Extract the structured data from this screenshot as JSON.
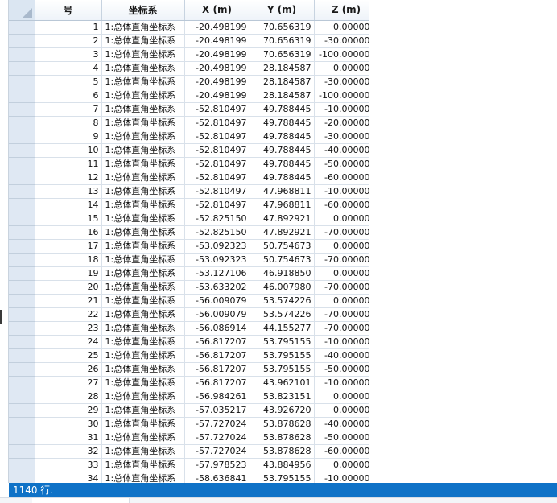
{
  "table": {
    "columns": [
      "",
      "号",
      "坐标系",
      "X (m)",
      "Y (m)",
      "Z (m)"
    ],
    "rows": [
      [
        "1",
        "1:总体直角坐标系",
        "-20.498199",
        "70.656319",
        "0.000000"
      ],
      [
        "2",
        "1:总体直角坐标系",
        "-20.498199",
        "70.656319",
        "-30.000000"
      ],
      [
        "3",
        "1:总体直角坐标系",
        "-20.498199",
        "70.656319",
        "-100.000000"
      ],
      [
        "4",
        "1:总体直角坐标系",
        "-20.498199",
        "28.184587",
        "0.000000"
      ],
      [
        "5",
        "1:总体直角坐标系",
        "-20.498199",
        "28.184587",
        "-30.000000"
      ],
      [
        "6",
        "1:总体直角坐标系",
        "-20.498199",
        "28.184587",
        "-100.000000"
      ],
      [
        "7",
        "1:总体直角坐标系",
        "-52.810497",
        "49.788445",
        "-10.000000"
      ],
      [
        "8",
        "1:总体直角坐标系",
        "-52.810497",
        "49.788445",
        "-20.000000"
      ],
      [
        "9",
        "1:总体直角坐标系",
        "-52.810497",
        "49.788445",
        "-30.000000"
      ],
      [
        "10",
        "1:总体直角坐标系",
        "-52.810497",
        "49.788445",
        "-40.000000"
      ],
      [
        "11",
        "1:总体直角坐标系",
        "-52.810497",
        "49.788445",
        "-50.000000"
      ],
      [
        "12",
        "1:总体直角坐标系",
        "-52.810497",
        "49.788445",
        "-60.000000"
      ],
      [
        "13",
        "1:总体直角坐标系",
        "-52.810497",
        "47.968811",
        "-10.000000"
      ],
      [
        "14",
        "1:总体直角坐标系",
        "-52.810497",
        "47.968811",
        "-60.000000"
      ],
      [
        "15",
        "1:总体直角坐标系",
        "-52.825150",
        "47.892921",
        "0.000000"
      ],
      [
        "16",
        "1:总体直角坐标系",
        "-52.825150",
        "47.892921",
        "-70.000000"
      ],
      [
        "17",
        "1:总体直角坐标系",
        "-53.092323",
        "50.754673",
        "0.000000"
      ],
      [
        "18",
        "1:总体直角坐标系",
        "-53.092323",
        "50.754673",
        "-70.000000"
      ],
      [
        "19",
        "1:总体直角坐标系",
        "-53.127106",
        "46.918850",
        "0.000000"
      ],
      [
        "20",
        "1:总体直角坐标系",
        "-53.633202",
        "46.007980",
        "-70.000000"
      ],
      [
        "21",
        "1:总体直角坐标系",
        "-56.009079",
        "53.574226",
        "0.000000"
      ],
      [
        "22",
        "1:总体直角坐标系",
        "-56.009079",
        "53.574226",
        "-70.000000"
      ],
      [
        "23",
        "1:总体直角坐标系",
        "-56.086914",
        "44.155277",
        "-70.000000"
      ],
      [
        "24",
        "1:总体直角坐标系",
        "-56.817207",
        "53.795155",
        "-10.000000"
      ],
      [
        "25",
        "1:总体直角坐标系",
        "-56.817207",
        "53.795155",
        "-40.000000"
      ],
      [
        "26",
        "1:总体直角坐标系",
        "-56.817207",
        "53.795155",
        "-50.000000"
      ],
      [
        "27",
        "1:总体直角坐标系",
        "-56.817207",
        "43.962101",
        "-10.000000"
      ],
      [
        "28",
        "1:总体直角坐标系",
        "-56.984261",
        "53.823151",
        "0.000000"
      ],
      [
        "29",
        "1:总体直角坐标系",
        "-57.035217",
        "43.926720",
        "0.000000"
      ],
      [
        "30",
        "1:总体直角坐标系",
        "-57.727024",
        "53.878628",
        "-40.000000"
      ],
      [
        "31",
        "1:总体直角坐标系",
        "-57.727024",
        "53.878628",
        "-50.000000"
      ],
      [
        "32",
        "1:总体直角坐标系",
        "-57.727024",
        "53.878628",
        "-60.000000"
      ],
      [
        "33",
        "1:总体直角坐标系",
        "-57.978523",
        "43.884956",
        "0.000000"
      ],
      [
        "34",
        "1:总体直角坐标系",
        "-58.636841",
        "53.795155",
        "-10.000000"
      ]
    ]
  },
  "status": {
    "text": "1140 行."
  },
  "colors": {
    "status_bar": "#0f72c7",
    "header_bg": "#eef3f9",
    "row_selector_bg": "#dfe8f3"
  },
  "icons": {
    "corner": "select-all-icon"
  }
}
